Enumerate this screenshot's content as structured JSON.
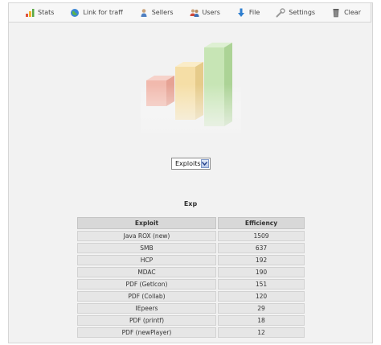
{
  "toolbar": {
    "items": [
      {
        "label": "Stats",
        "icon": "stats-icon"
      },
      {
        "label": "Link for traff",
        "icon": "globe-icon"
      },
      {
        "label": "Sellers",
        "icon": "person-icon"
      },
      {
        "label": "Users",
        "icon": "users-icon"
      },
      {
        "label": "File",
        "icon": "download-arrow-icon"
      },
      {
        "label": "Settings",
        "icon": "wrench-icon"
      },
      {
        "label": "Clear",
        "icon": "trash-icon"
      }
    ]
  },
  "logo": {
    "icon": "bar-chart-logo-icon",
    "colors": [
      "#f1b9ad",
      "#f5dea6",
      "#c7e5b5"
    ]
  },
  "filter": {
    "selected": "Exploits"
  },
  "section_title": "Exp",
  "table": {
    "headers": [
      "Exploit",
      "Efficiency"
    ],
    "rows": [
      [
        "Java ROX (new)",
        "1509"
      ],
      [
        "SMB",
        "637"
      ],
      [
        "HCP",
        "192"
      ],
      [
        "MDAC",
        "190"
      ],
      [
        "PDF (GetIcon)",
        "151"
      ],
      [
        "PDF (Collab)",
        "120"
      ],
      [
        "IEpeers",
        "29"
      ],
      [
        "PDF (printf)",
        "18"
      ],
      [
        "PDF (newPlayer)",
        "12"
      ]
    ]
  }
}
